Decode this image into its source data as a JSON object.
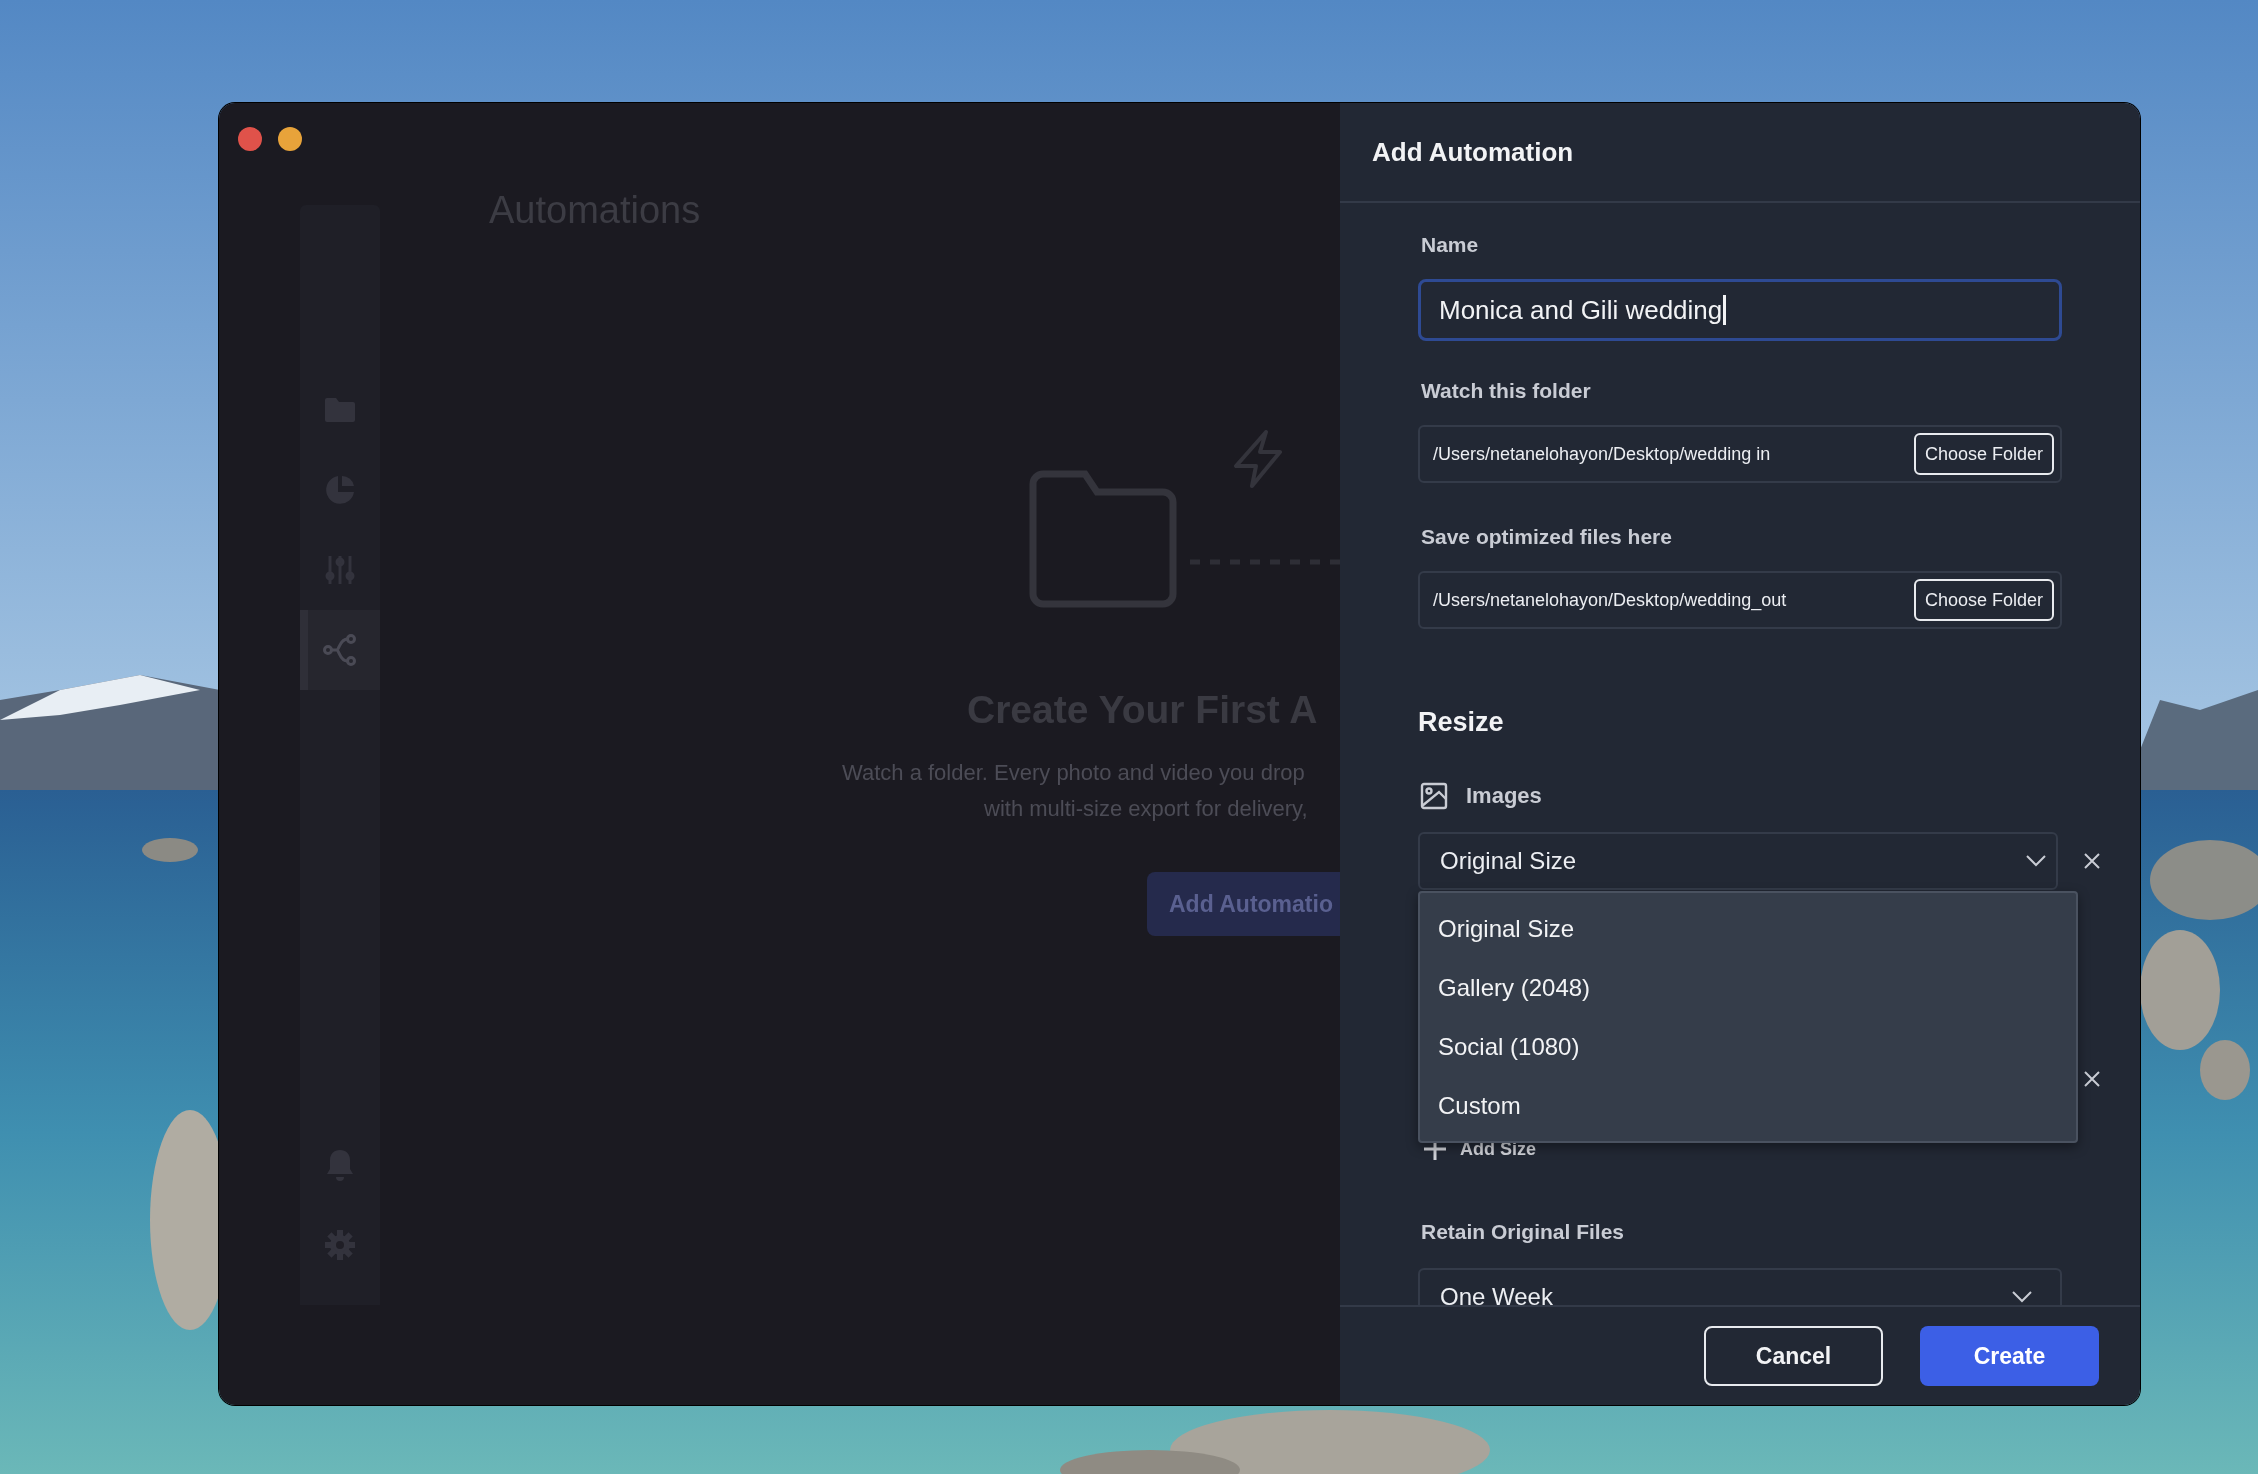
{
  "window": {
    "controls": [
      {
        "kind": "close"
      },
      {
        "kind": "minimize"
      }
    ]
  },
  "sidebar": {
    "items": [
      {
        "selected": false
      },
      {
        "selected": false
      },
      {
        "selected": false
      },
      {
        "selected": true
      }
    ]
  },
  "main": {
    "title": "Automations",
    "empty_state": {
      "heading": "Create Your First A",
      "lines": [
        "Watch a folder. Every photo and video you drop",
        "with multi-size export for delivery,"
      ],
      "button": "Add Automatio"
    }
  },
  "panel": {
    "title": "Add Automation",
    "name": {
      "label": "Name",
      "value": "Monica and Gili wedding",
      "focused": true
    },
    "watch_folder": {
      "label": "Watch this folder",
      "value": "/Users/netanelohayon/Desktop/wedding in",
      "button": "Choose Folder"
    },
    "output_folder": {
      "label": "Save optimized files here",
      "value": "/Users/netanelohayon/Desktop/wedding_out",
      "button": "Choose Folder"
    },
    "resize": {
      "title": "Resize",
      "media_label": "Images",
      "size_rows": [
        {
          "kind": "select",
          "value": "Original Size",
          "open": true
        },
        {
          "kind": "covered"
        }
      ],
      "options": [
        "Original Size",
        "Gallery (2048)",
        "Social (1080)",
        "Custom"
      ],
      "add_button": "Add Size"
    },
    "retain": {
      "label": "Retain Original Files",
      "value": "One Week"
    },
    "buttons": [
      {
        "label": "Cancel",
        "kind": "secondary"
      },
      {
        "label": "Create",
        "kind": "primary"
      }
    ]
  }
}
